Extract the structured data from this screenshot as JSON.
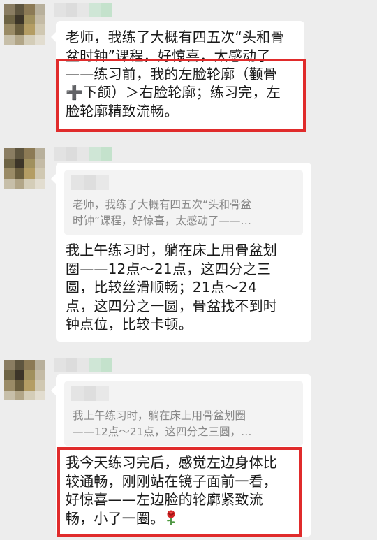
{
  "messages": [
    {
      "text_line1": "老师，我练了大概有四五次“头和骨",
      "text_line2": "盆时钟”课程，好惊喜，太感动了",
      "text_line3": "——练习前，我的左脸轮廓（颧骨",
      "text_line4": "➕下颌）＞右脸轮廓；练习完，左",
      "text_line5": "脸轮廓精致流畅。"
    },
    {
      "quote_line1": "老师，我练了大概有四五次“头和骨盆",
      "quote_line2": "时钟”课程，好惊喜，太感动了——…",
      "text_line1": "我上午练习时，躺在床上用骨盆划",
      "text_line2": "圈——12点～21点，这四分之三",
      "text_line3": "圆，比较丝滑顺畅；21点～24",
      "text_line4": "点，这四分之一圆，骨盆找不到时",
      "text_line5": "钟点位，比较卡顿。"
    },
    {
      "quote_line1": "我上午练习时，躺在床上用骨盆划圈",
      "quote_line2": "——12点～21点，这四分之三圆，…",
      "text_line1": "我今天练习完后，感觉左边身体比",
      "text_line2": "较通畅，刚刚站在镜子面前一看，",
      "text_line3": "好惊喜——左边脸的轮廓紧致流",
      "text_line4": "畅，小了一圈。",
      "emoji": "rose-emoji"
    }
  ],
  "colors": {
    "highlight": "#e02b2b",
    "background": "#ededed",
    "bubble": "#ffffff",
    "quote_bg": "#f3f3f3",
    "quote_text": "#888888"
  }
}
